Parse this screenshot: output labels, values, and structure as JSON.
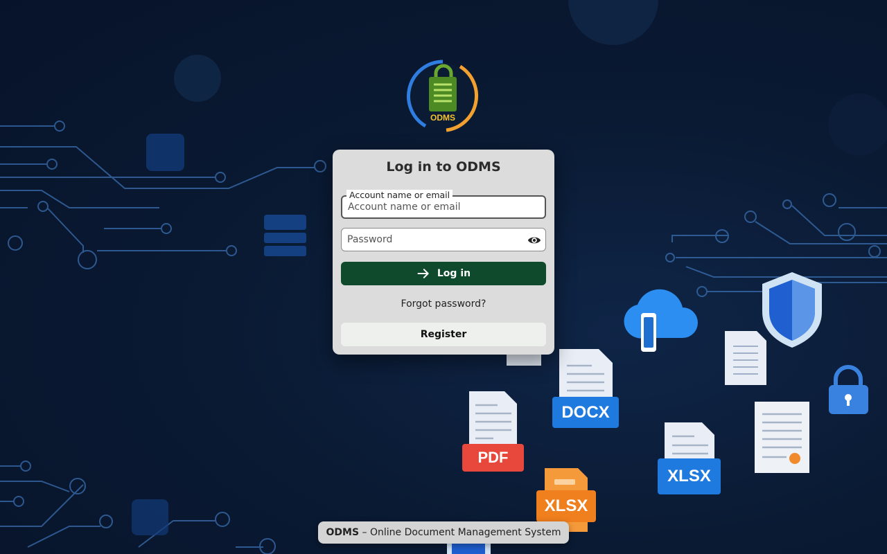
{
  "app": {
    "logo_text": "ODMS"
  },
  "login_card": {
    "title": "Log in to ODMS",
    "account_field": {
      "label": "Account name or email",
      "placeholder": "Account name or email",
      "value": ""
    },
    "password_field": {
      "placeholder": "Password",
      "value": "",
      "toggle_icon": "eye-icon"
    },
    "login_button": {
      "label": "Log in",
      "icon": "arrow-right-icon"
    },
    "forgot_password": "Forgot password?",
    "register_button": "Register"
  },
  "footer": {
    "brand": "ODMS",
    "separator": " – ",
    "description": "Online Document Management System"
  },
  "illustration_badges": {
    "docx": "DOCX",
    "pdf": "PDF",
    "xlsx_a": "XLSX",
    "xlsx_b": "XLSX"
  },
  "colors": {
    "login_button": "#0f4a2c",
    "card_bg": "#dcdcdc",
    "background": "#0a1a33",
    "circuit": "#3a6fb0",
    "docx_badge": "#1f7ae0",
    "pdf_badge": "#e8473c",
    "xlsx_badge_orange": "#f07f1e",
    "xlsx_badge_blue": "#1f7ae0"
  }
}
